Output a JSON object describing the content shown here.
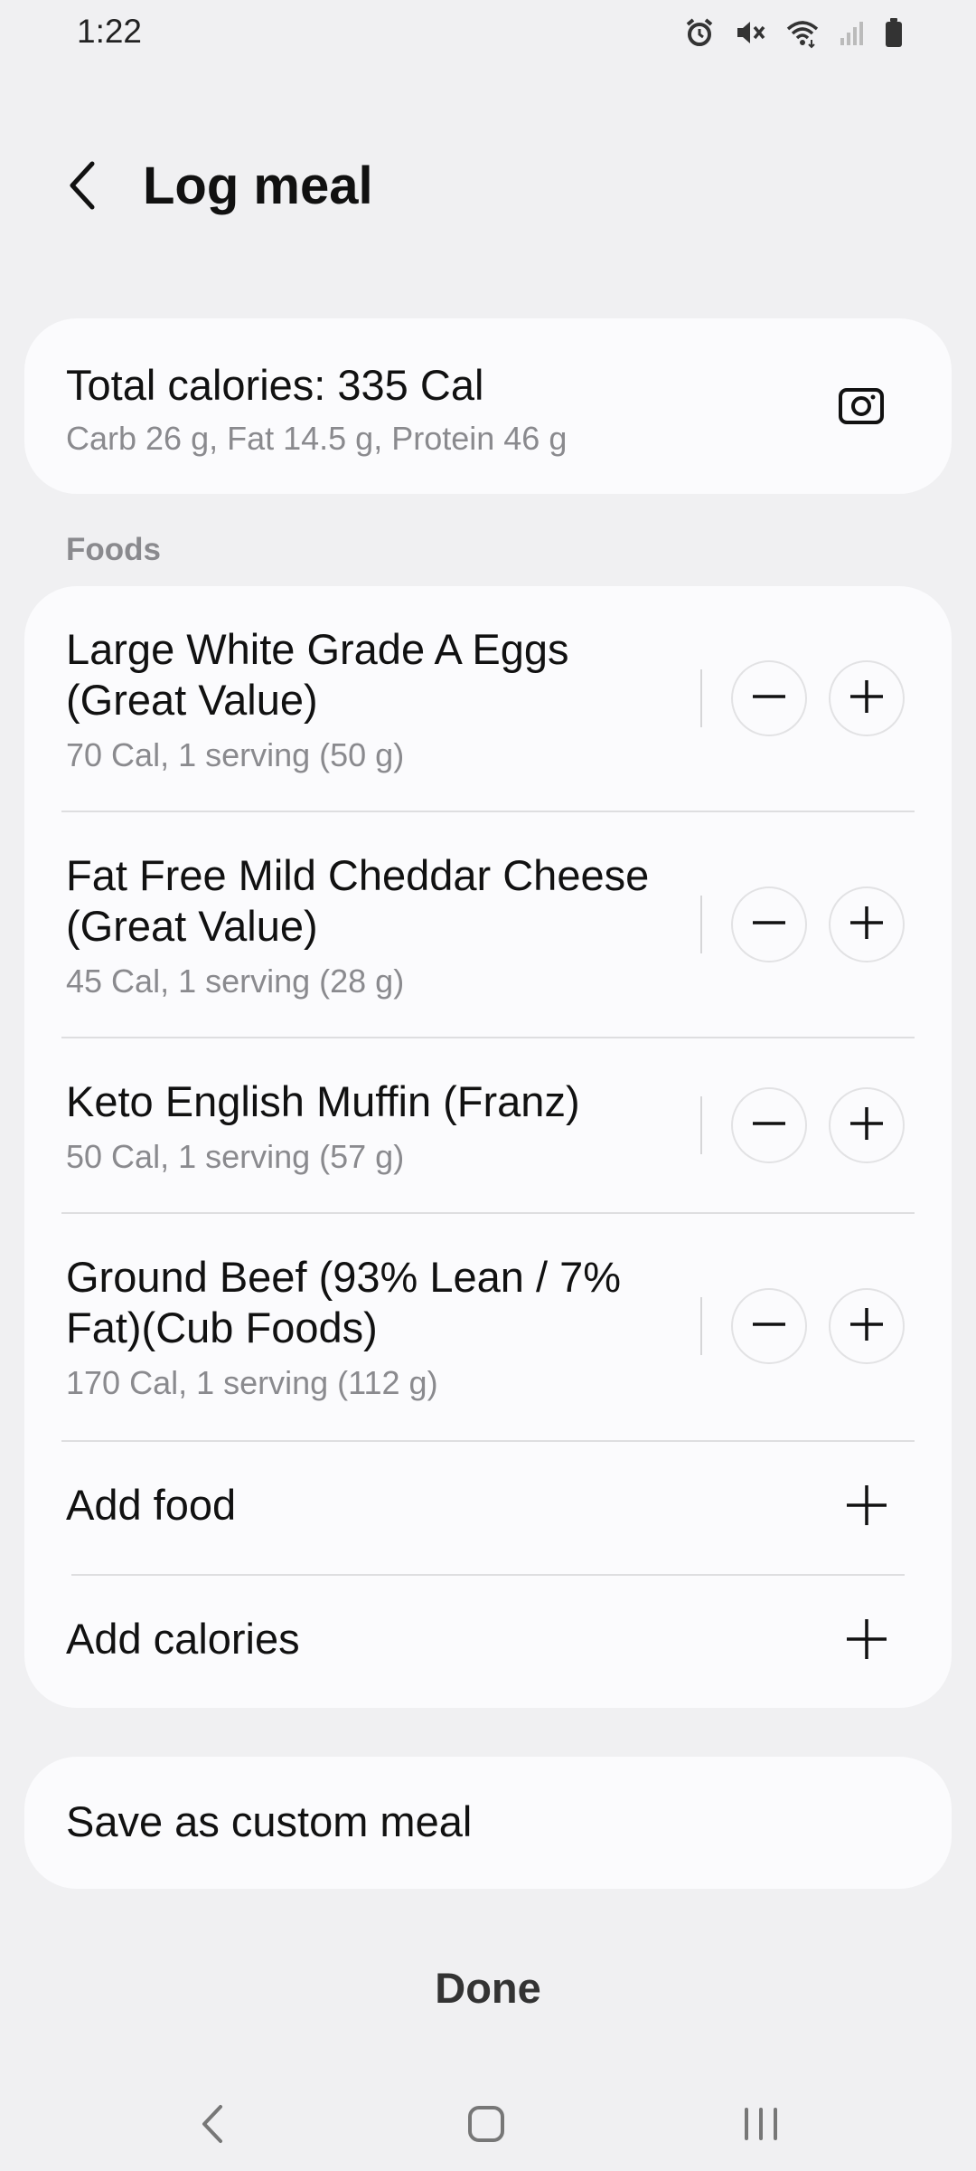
{
  "status_bar": {
    "time": "1:22",
    "icons": [
      "alarm-icon",
      "mute-icon",
      "wifi-icon",
      "signal-icon",
      "battery-icon"
    ]
  },
  "header": {
    "title": "Log meal",
    "back_icon": "back-arrow-icon"
  },
  "summary": {
    "total_calories": "Total calories: 335 Cal",
    "macros": "Carb 26 g, Fat 14.5 g, Protein 46 g",
    "camera_icon": "camera-icon"
  },
  "foods_section": {
    "label": "Foods",
    "items": [
      {
        "name": "Large White Grade A Eggs (Great Value)",
        "detail": "70 Cal, 1 serving (50 g)"
      },
      {
        "name": "Fat Free Mild Cheddar Cheese (Great Value)",
        "detail": "45 Cal, 1 serving (28 g)"
      },
      {
        "name": "Keto English Muffin (Franz)",
        "detail": "50 Cal, 1 serving (57 g)"
      },
      {
        "name": "Ground Beef (93% Lean / 7% Fat)(Cub Foods)",
        "detail": "170 Cal, 1 serving (112 g)"
      }
    ],
    "add_food": "Add food",
    "add_calories": "Add calories"
  },
  "custom_meal": {
    "label": "Save as custom meal"
  },
  "done": {
    "label": "Done"
  },
  "nav_bar": {
    "icons": [
      "nav-back-icon",
      "nav-home-icon",
      "nav-recents-icon"
    ]
  },
  "colors": {
    "background": "#f0f0f2",
    "card": "#fbfbfd",
    "secondary_text": "#8a8a8e"
  }
}
